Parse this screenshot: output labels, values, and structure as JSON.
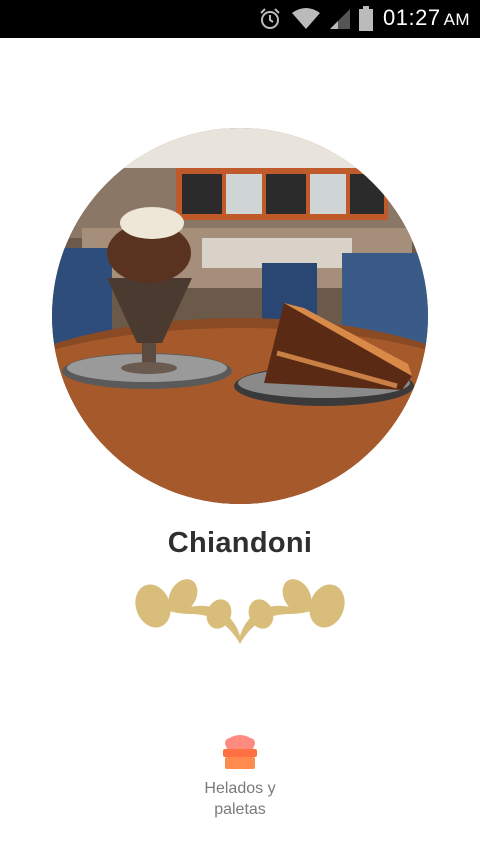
{
  "status_bar": {
    "time": "01:27",
    "ampm": "AM",
    "icons": [
      "alarm-icon",
      "wifi-icon",
      "signal-icon",
      "battery-icon"
    ]
  },
  "place": {
    "name": "Chiandoni",
    "image": "cafe-dessert-photo"
  },
  "category": {
    "label": "Helados y paletas",
    "icon": "ice-cream-icon",
    "icon_color": "#ff8a65"
  },
  "colors": {
    "ornament": "#d9bd7a",
    "title": "#2f2f2f"
  }
}
